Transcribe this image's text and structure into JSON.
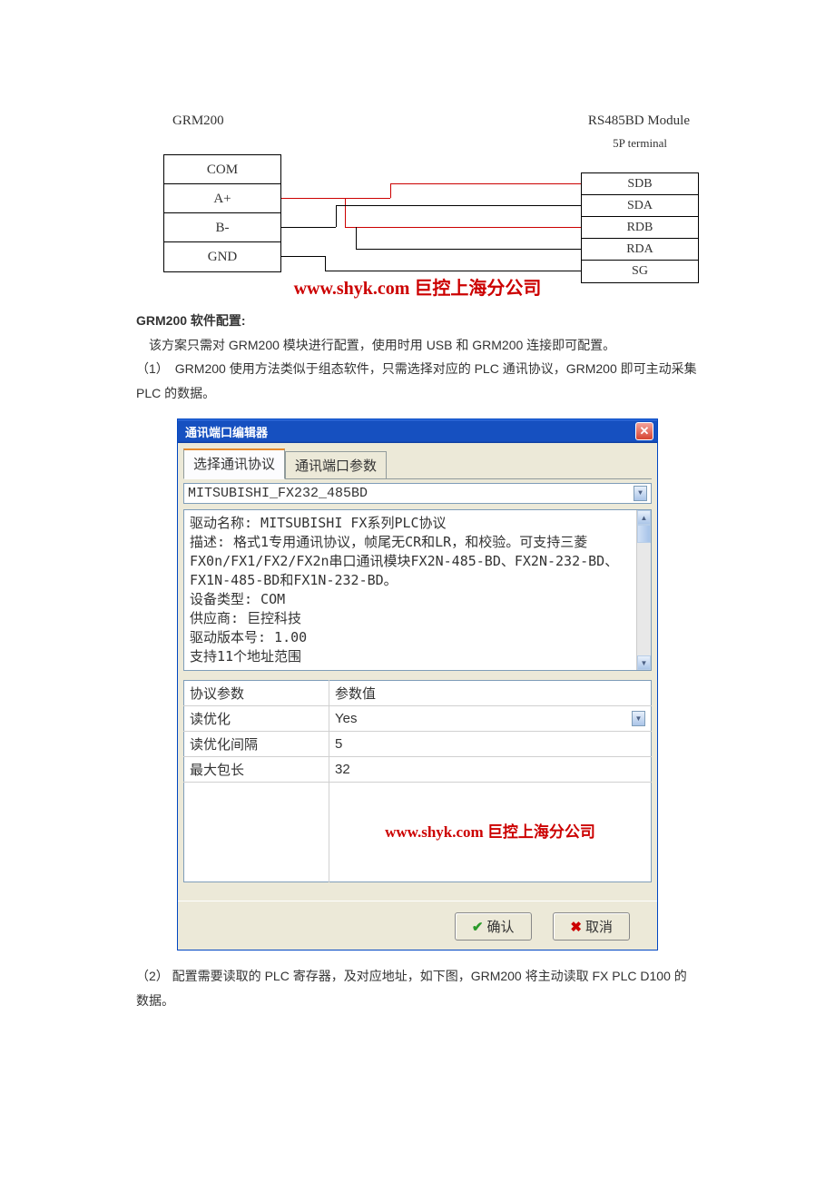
{
  "diagram": {
    "left_title": "GRM200",
    "right_title": "RS485BD Module",
    "right_subtitle": "5P terminal",
    "left_pins": [
      "COM",
      "A+",
      "B-",
      "GND"
    ],
    "right_pins": [
      "SDB",
      "SDA",
      "RDB",
      "RDA",
      "SG"
    ],
    "watermark": "www.shyk.com 巨控上海分公司"
  },
  "text": {
    "title": "GRM200 软件配置:",
    "p1": "该方案只需对 GRM200 模块进行配置，使用时用 USB 和 GRM200 连接即可配置。",
    "p2": "（1）　GRM200 使用方法类似于组态软件，只需选择对应的 PLC 通讯协议，GRM200 即可主动采集 PLC 的数据。",
    "after": "（2） 配置需要读取的 PLC 寄存器，及对应地址，如下图，GRM200 将主动读取 FX PLC D100 的数据。"
  },
  "dialog": {
    "title": "通讯端口编辑器",
    "tabs": {
      "active": "选择通讯协议",
      "inactive": "通讯端口参数"
    },
    "protocol": "MITSUBISHI_FX232_485BD",
    "desc": "驱动名称: MITSUBISHI FX系列PLC协议\n描述: 格式1专用通讯协议，帧尾无CR和LR，和校验。可支持三菱FX0n/FX1/FX2/FX2n串口通讯模块FX2N-485-BD、FX2N-232-BD、FX1N-485-BD和FX1N-232-BD。\n设备类型: COM\n供应商: 巨控科技\n驱动版本号: 1.00\n支持11个地址范围",
    "table": {
      "h1": "协议参数",
      "h2": "参数值",
      "rows": [
        {
          "k": "读优化",
          "v": "Yes",
          "dd": true
        },
        {
          "k": "读优化间隔",
          "v": "5"
        },
        {
          "k": "最大包长",
          "v": "32"
        }
      ]
    },
    "watermark": "www.shyk.com 巨控上海分公司",
    "ok": "确认",
    "cancel": "取消"
  }
}
